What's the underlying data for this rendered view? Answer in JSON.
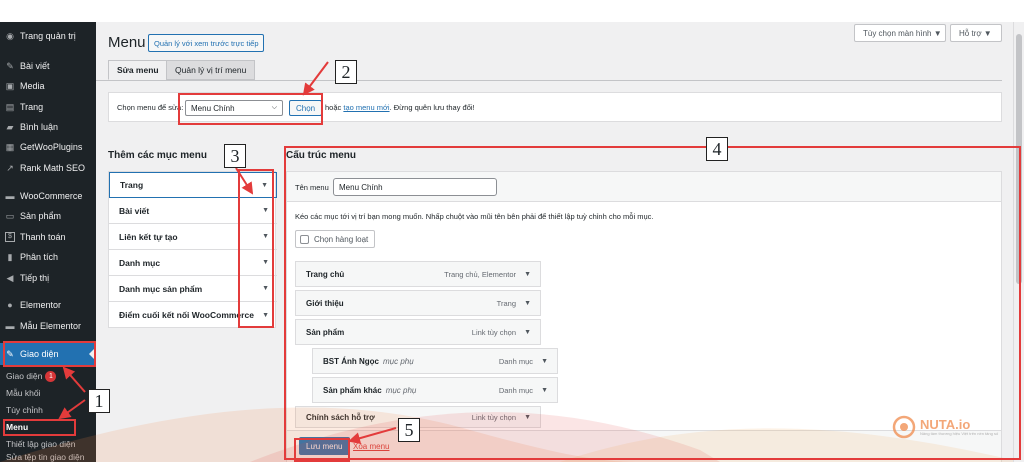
{
  "sidebar": {
    "items": [
      {
        "icon": "dashboard-icon",
        "glyph": "◉",
        "label": "Trang quản trị"
      },
      {
        "icon": "pin-icon",
        "glyph": "✎",
        "label": "Bài viết"
      },
      {
        "icon": "media-icon",
        "glyph": "▣",
        "label": "Media"
      },
      {
        "icon": "page-icon",
        "glyph": "▤",
        "label": "Trang"
      },
      {
        "icon": "comment-icon",
        "glyph": "▰",
        "label": "Bình luận"
      },
      {
        "icon": "plugin-icon",
        "glyph": "▦",
        "label": "GetWooPlugins"
      },
      {
        "icon": "rankmath-icon",
        "glyph": "↗",
        "label": "Rank Math SEO"
      },
      {
        "icon": "woo-icon",
        "glyph": "▬",
        "label": "WooCommerce"
      },
      {
        "icon": "product-icon",
        "glyph": "▭",
        "label": "Sản phẩm"
      },
      {
        "icon": "payment-icon",
        "glyph": "$",
        "label": "Thanh toán"
      },
      {
        "icon": "analytics-icon",
        "glyph": "▮",
        "label": "Phân tích"
      },
      {
        "icon": "megaphone-icon",
        "glyph": "◀",
        "label": "Tiếp thị"
      },
      {
        "icon": "elementor-icon",
        "glyph": "●",
        "label": "Elementor"
      },
      {
        "icon": "folder-icon",
        "glyph": "▬",
        "label": "Mẫu Elementor"
      },
      {
        "icon": "appearance-icon",
        "glyph": "✎",
        "label": "Giao diện"
      }
    ],
    "submenu": [
      {
        "label": "Giao diện",
        "badge": "1"
      },
      {
        "label": "Mẫu khối"
      },
      {
        "label": "Tùy chỉnh"
      },
      {
        "label": "Menu"
      },
      {
        "label": "Thiết lập giao diện"
      },
      {
        "label": "Sửa tệp tin giao diện"
      }
    ]
  },
  "header": {
    "title": "Menu",
    "live_preview": "Quản lý với xem trước trực tiếp",
    "screen_options": "Tùy chọn màn hình ▼",
    "help": "Hỗ trợ ▼"
  },
  "tabs": [
    "Sửa menu",
    "Quản lý vị trí menu"
  ],
  "select_bar": {
    "label": "Chọn menu để sửa:",
    "selected": "Menu Chính",
    "choose_button": "Chọn",
    "or_text": "hoặc",
    "create_link": "tạo menu mới",
    "note": ". Đừng quên lưu thay đổi!"
  },
  "add_items": {
    "title": "Thêm các mục menu",
    "sections": [
      "Trang",
      "Bài viết",
      "Liên kết tự tạo",
      "Danh mục",
      "Danh mục sản phẩm",
      "Điểm cuối kết nối WooCommerce"
    ]
  },
  "structure": {
    "title": "Cấu trúc menu",
    "name_label": "Tên menu",
    "name_value": "Menu Chính",
    "instructions": "Kéo các mục tới vị trí bạn mong muốn. Nhấp chuột vào mũi tên bên phải để thiết lập tuỳ chỉnh cho mỗi mục.",
    "bulk_select": "Chọn hàng loạt",
    "items": [
      {
        "title": "Trang chủ",
        "sub": "",
        "type": "Trang chủ, Elementor",
        "depth": 0
      },
      {
        "title": "Giới thiệu",
        "sub": "",
        "type": "Trang",
        "depth": 0
      },
      {
        "title": "Sản phẩm",
        "sub": "",
        "type": "Link tùy chọn",
        "depth": 0
      },
      {
        "title": "BST Ánh Ngọc",
        "sub": "mục phụ",
        "type": "Danh mục",
        "depth": 1
      },
      {
        "title": "Sản phẩm khác",
        "sub": "mục phụ",
        "type": "Danh mục",
        "depth": 1
      },
      {
        "title": "Chính sách hỗ trợ",
        "sub": "",
        "type": "Link tùy chọn",
        "depth": 0
      }
    ],
    "save_button": "Lưu menu",
    "delete_link": "Xóa menu"
  },
  "callouts": [
    "1",
    "2",
    "3",
    "4",
    "5"
  ],
  "watermark": {
    "brand": "NUTA.io",
    "tagline": "Nâng tầm thương hiệu Việt trên nền tảng số"
  },
  "colors": {
    "accent": "#2271b1",
    "sidebar": "#1d2327",
    "annotation_red": "#e33b3b"
  }
}
